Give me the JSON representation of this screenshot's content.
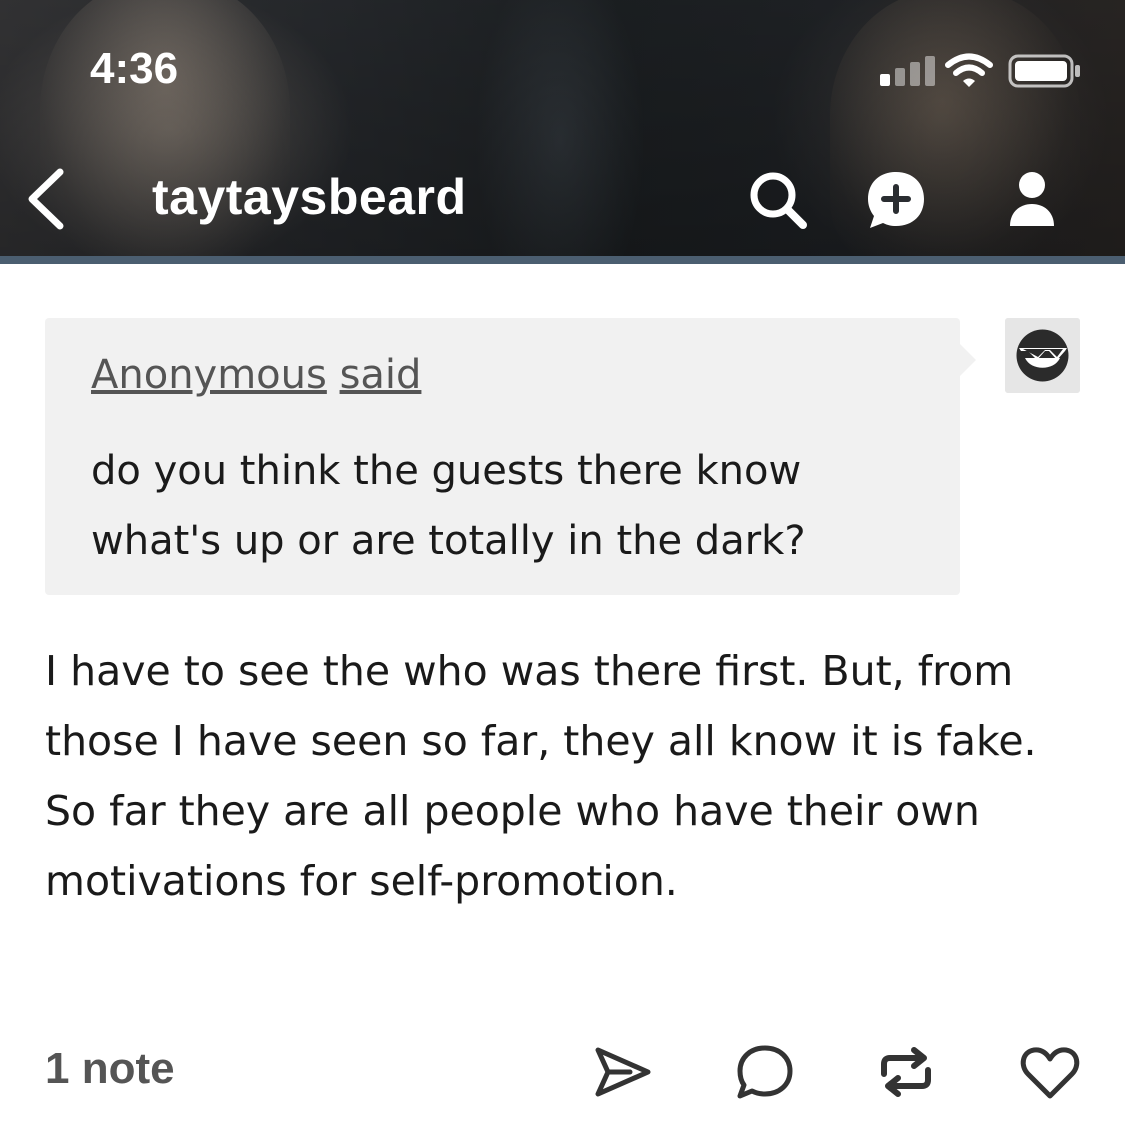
{
  "status_bar": {
    "time": "4:36",
    "signal_icon": "cellular-signal-icon",
    "wifi_icon": "wifi-icon",
    "battery_icon": "battery-icon"
  },
  "header": {
    "back_icon": "chevron-left-icon",
    "blog_name": "taytaysbeard",
    "search_icon": "search-icon",
    "ask_icon": "add-chat-icon",
    "follow_icon": "person-icon",
    "divider_color": "#4b5e70"
  },
  "ask": {
    "asker": "Anonymous",
    "said": "said",
    "question": "do you think the guests there know what's up or are totally in the dark?",
    "avatar_icon": "anonymous-sunglasses-avatar"
  },
  "answer": {
    "text": "I have to see the who was there first. But, from those I have seen so far, they all know it is fake. So far they are all people who have their own motivations for self-promotion."
  },
  "footer": {
    "notes": "1 note",
    "share_icon": "share-icon",
    "reply_icon": "reply-icon",
    "reblog_icon": "reblog-icon",
    "like_icon": "heart-icon"
  }
}
